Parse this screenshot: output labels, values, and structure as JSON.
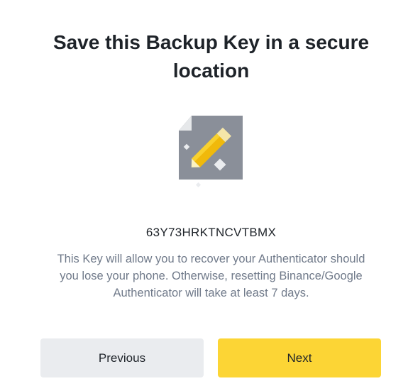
{
  "dialog": {
    "title_line1": "Save this Backup Key in a secure",
    "title_line2": "location",
    "illustration_icon": "paper-pencil-icon",
    "backup_key": "63Y73HRKTNCVTBMX",
    "description_line1": "This Key will allow you to recover your Authenticator should",
    "description_line2": "you lose your phone. Otherwise, resetting Binance/Google",
    "description_line3": "Authenticator will take at least 7 days.",
    "previous_label": "Previous",
    "next_label": "Next"
  },
  "colors": {
    "title": "#1e2329",
    "description": "#707a8a",
    "previous_bg": "#eaecef",
    "next_bg": "#fcd535",
    "pencil": "#f0b90b"
  }
}
